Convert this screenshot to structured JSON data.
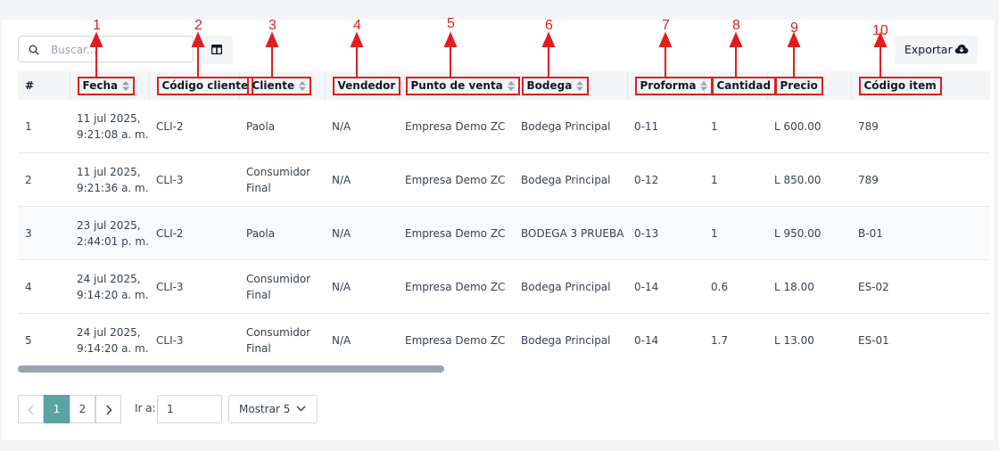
{
  "search": {
    "placeholder": "Buscar...",
    "icon": "search-icon"
  },
  "toolbar": {
    "columns_icon": "columns-icon",
    "export_label": "Exportar",
    "export_icon": "cloud-download-icon"
  },
  "annotation_color": "#e11d1d",
  "annotations": [
    "1",
    "2",
    "3",
    "4",
    "5",
    "6",
    "7",
    "8",
    "9",
    "10"
  ],
  "table": {
    "headers": [
      "#",
      "Fecha",
      "Código cliente",
      "Cliente",
      "Vendedor",
      "Punto de venta",
      "Bodega",
      "Proforma",
      "Cantidad",
      "Precio",
      "Código item"
    ],
    "rows": [
      [
        "1",
        "11 jul 2025, 9:21:08 a. m.",
        "CLI-2",
        "Paola",
        "N/A",
        "Empresa Demo ZC",
        "Bodega Principal",
        "0-11",
        "1",
        "L 600.00",
        "789"
      ],
      [
        "2",
        "11 jul 2025, 9:21:36 a. m.",
        "CLI-3",
        "Consumidor Final",
        "N/A",
        "Empresa Demo ZC",
        "Bodega Principal",
        "0-12",
        "1",
        "L 850.00",
        "789"
      ],
      [
        "3",
        "23 jul 2025, 2:44:01 p. m.",
        "CLI-2",
        "Paola",
        "N/A",
        "Empresa Demo ZC",
        "BODEGA 3 PRUEBA",
        "0-13",
        "1",
        "L 950.00",
        "B-01"
      ],
      [
        "4",
        "24 jul 2025, 9:14:20 a. m.",
        "CLI-3",
        "Consumidor Final",
        "N/A",
        "Empresa Demo ZC",
        "Bodega Principal",
        "0-14",
        "0.6",
        "L 18.00",
        "ES-02"
      ],
      [
        "5",
        "24 jul 2025, 9:14:20 a. m.",
        "CLI-3",
        "Consumidor Final",
        "N/A",
        "Empresa Demo ZC",
        "Bodega Principal",
        "0-14",
        "1.7",
        "L 13.00",
        "ES-01"
      ]
    ]
  },
  "pagination": {
    "pages": [
      "1",
      "2"
    ],
    "current": "1",
    "goto_label": "Ir a:",
    "goto_value": "1",
    "page_size_label": "Mostrar 5",
    "accent": "#5aa3a3"
  }
}
